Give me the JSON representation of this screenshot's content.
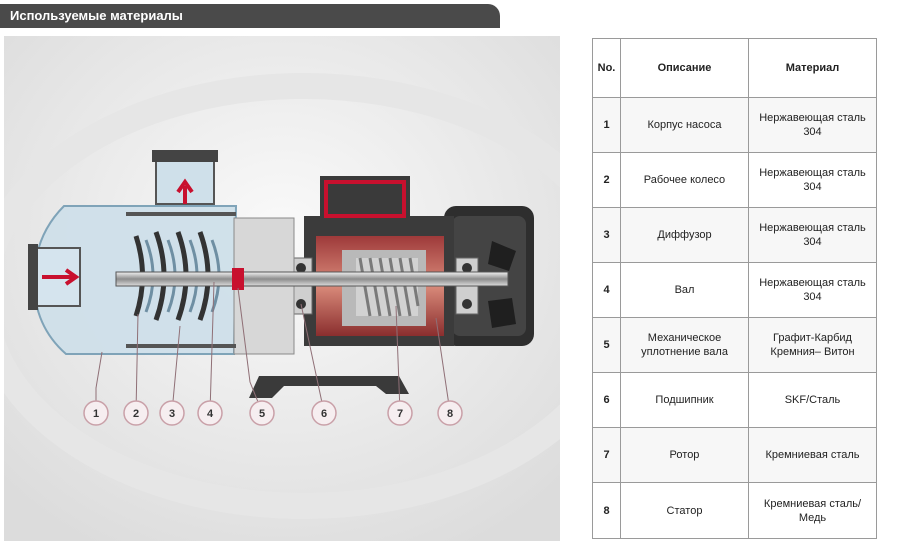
{
  "header": {
    "title": "Используемые материалы"
  },
  "callouts": [
    "1",
    "2",
    "3",
    "4",
    "5",
    "6",
    "7",
    "8"
  ],
  "table": {
    "columns": [
      "No.",
      "Описание",
      "Материал"
    ],
    "rows": [
      {
        "no": "1",
        "description": "Корпус насоса",
        "material": "Нержавеющая сталь 304"
      },
      {
        "no": "2",
        "description": "Рабочее колесо",
        "material": "Нержавеющая сталь 304"
      },
      {
        "no": "3",
        "description": "Диффузор",
        "material": "Нержавеющая сталь 304"
      },
      {
        "no": "4",
        "description": "Вал",
        "material": "Нержавеющая сталь 304"
      },
      {
        "no": "5",
        "description": "Механическое\nуплотнение вала",
        "material": "Графит-Карбид\nКремния– Витон"
      },
      {
        "no": "6",
        "description": "Подшипник",
        "material": "SKF/Сталь"
      },
      {
        "no": "7",
        "description": "Ротор",
        "material": "Кремниевая сталь"
      },
      {
        "no": "8",
        "description": "Статор",
        "material": "Кремниевая сталь/\nМедь"
      }
    ]
  },
  "colors": {
    "header_bg": "#4a4a4a",
    "accent_red": "#c8102e",
    "callout_border": "#c9a0a8"
  }
}
